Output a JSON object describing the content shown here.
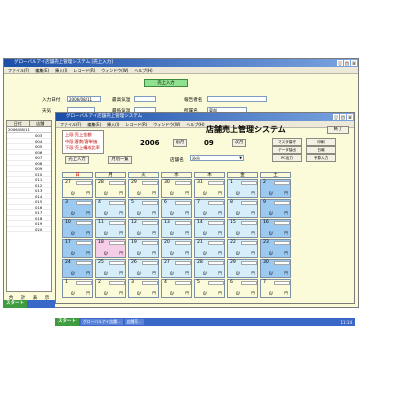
{
  "back_window": {
    "title": "グローバルアイ店舗売上管理システム [売上入力]",
    "menu": [
      "ファイル(F)",
      "編集(E)",
      "挿入(I)",
      "レコード(R)",
      "ウィンドウ(W)",
      "ヘルプ(H)"
    ],
    "header_button": "売上入力",
    "fields": {
      "input_date_label": "入力日付",
      "input_date_value": "2006/08/11",
      "weather_label": "天気",
      "max_temp_label": "最高気温",
      "min_temp_label": "最低気温",
      "reporter_label": "報告者名",
      "dept_label": "所属名",
      "dept_value": "東部"
    },
    "list_header": [
      "日付",
      "店舗"
    ],
    "list_first_date": "2006/08/11",
    "list_codes": [
      "003",
      "004",
      "005",
      "006",
      "007",
      "008",
      "009",
      "010",
      "011",
      "012",
      "013",
      "014",
      "015",
      "016",
      "017",
      "018",
      "019",
      "020"
    ],
    "bottom_labels": [
      "合",
      "計",
      "表",
      "示"
    ]
  },
  "front_window": {
    "title": "グローバルアイ店舗売上管理システム",
    "menu": [
      "ファイル(F)",
      "編集(E)",
      "挿入(I)",
      "レコード(R)",
      "ウィンドウ(W)",
      "ヘルプ(H)"
    ],
    "info_lines": [
      "上段:売上金額",
      "中段:客数/客単価",
      "下段:売上構成比率"
    ],
    "system_title": "店舗売上管理システム",
    "exit_button": "終了",
    "year": "2006",
    "prev_button": "前月",
    "month": "09",
    "next_button": "次月",
    "btn_sales_input": "売上入力",
    "btn_monthly": "月別一覧",
    "store_label": "店舗名",
    "store_value": "渋谷",
    "right_buttons": [
      "マスタ保守",
      "印刷",
      "データ抽出",
      "日報",
      "PC出力",
      "予算入力"
    ],
    "weekdays": [
      "日",
      "月",
      "火",
      "水",
      "木",
      "金",
      "土"
    ],
    "weeks": [
      [
        "27",
        "28",
        "29",
        "30",
        "31",
        "1",
        "2"
      ],
      [
        "3",
        "4",
        "5",
        "6",
        "7",
        "8",
        "9"
      ],
      [
        "10",
        "11",
        "12",
        "13",
        "14",
        "15",
        "16"
      ],
      [
        "17",
        "18",
        "19",
        "20",
        "21",
        "22",
        "23"
      ],
      [
        "24",
        "25",
        "26",
        "27",
        "28",
        "29",
        "30"
      ],
      [
        "1",
        "2",
        "3",
        "4",
        "5",
        "6",
        "7"
      ]
    ],
    "cell_slash": "0/",
    "cell_yen": "円"
  },
  "taskbar": {
    "start": "スタート",
    "items": [
      "グローバルアイ店舗...",
      "店舗売..."
    ],
    "clock": "11:14"
  },
  "colors": {
    "window_bg": "#fbfbd9",
    "weekday_cell": "#d6eefa",
    "weekend_cell": "#9cc9f0",
    "highlight_cell": "#f5cde7",
    "titlebar": "#1c4fa8",
    "sunday_text": "#cc0000"
  }
}
